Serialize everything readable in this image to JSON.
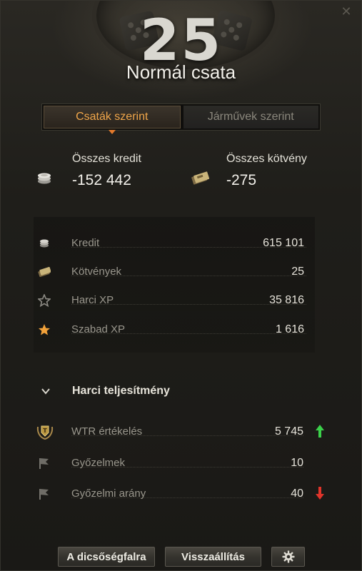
{
  "header": {
    "battle_count": "25",
    "title": "Normál csata"
  },
  "tabs": [
    {
      "label": "Csaták szerint",
      "active": true
    },
    {
      "label": "Járművek szerint",
      "active": false
    }
  ],
  "totals": {
    "credits_label": "Összes kredit",
    "credits_value": "-152 442",
    "bonds_label": "Összes kötvény",
    "bonds_value": "-275"
  },
  "resources": [
    {
      "label": "Kredit",
      "value": "615 101",
      "icon": "credits-icon"
    },
    {
      "label": "Kötvények",
      "value": "25",
      "icon": "bonds-icon"
    },
    {
      "label": "Harci XP",
      "value": "35 816",
      "icon": "star-outline-icon"
    },
    {
      "label": "Szabad XP",
      "value": "1 616",
      "icon": "star-gold-icon"
    }
  ],
  "performance": {
    "title": "Harci teljesítmény",
    "rows": [
      {
        "label": "WTR értékelés",
        "value": "5 745",
        "icon": "wtr-rating-icon",
        "trend": "up"
      },
      {
        "label": "Győzelmek",
        "value": "10",
        "icon": "flag-icon",
        "trend": "none"
      },
      {
        "label": "Győzelmi arány",
        "value": "40",
        "icon": "flag-icon",
        "trend": "down"
      }
    ]
  },
  "buttons": {
    "hall_of_fame": "A dicsőségfalra",
    "reset": "Visszaállítás",
    "settings_icon": "gear-icon"
  },
  "colors": {
    "accent_orange": "#f0a64a",
    "trend_up": "#3bd14a",
    "trend_down": "#e0342a"
  }
}
